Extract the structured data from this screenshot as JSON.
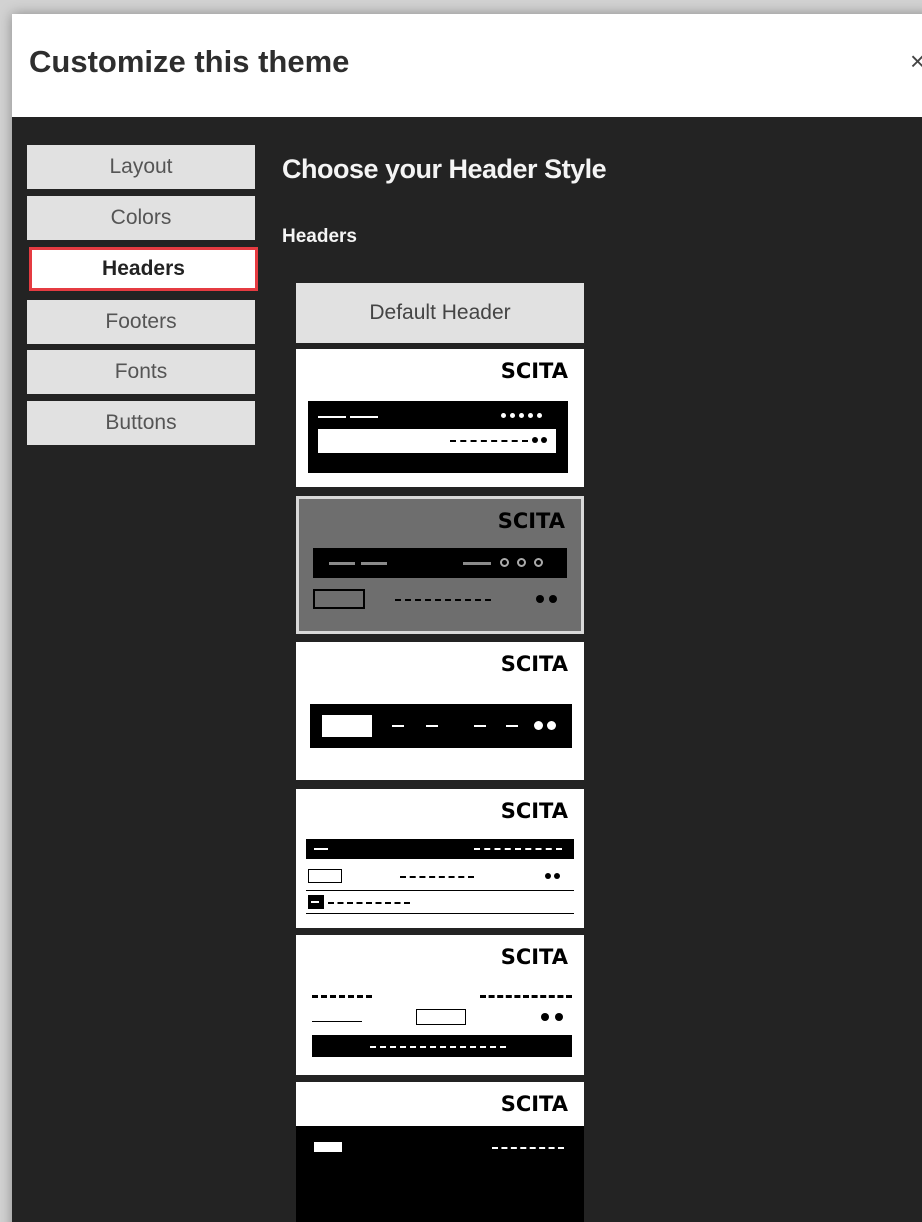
{
  "modal": {
    "title": "Customize this theme",
    "close_label": "×"
  },
  "sidebar": {
    "items": [
      {
        "label": "Layout",
        "active": false
      },
      {
        "label": "Colors",
        "active": false
      },
      {
        "label": "Headers",
        "active": true
      },
      {
        "label": "Footers",
        "active": false
      },
      {
        "label": "Fonts",
        "active": false
      },
      {
        "label": "Buttons",
        "active": false
      }
    ]
  },
  "main": {
    "title": "Choose your Header Style",
    "subtitle": "Headers",
    "default_header_label": "Default Header",
    "cards": [
      {
        "label": "SCITA"
      },
      {
        "label": "SCITA"
      },
      {
        "label": "SCITA"
      },
      {
        "label": "SCITA"
      },
      {
        "label": "SCITA"
      },
      {
        "label": "SCITA"
      }
    ]
  },
  "colors": {
    "accent_highlight": "#e53b41",
    "panel_background": "#232323",
    "sidebar_item": "#e1e1e1"
  }
}
